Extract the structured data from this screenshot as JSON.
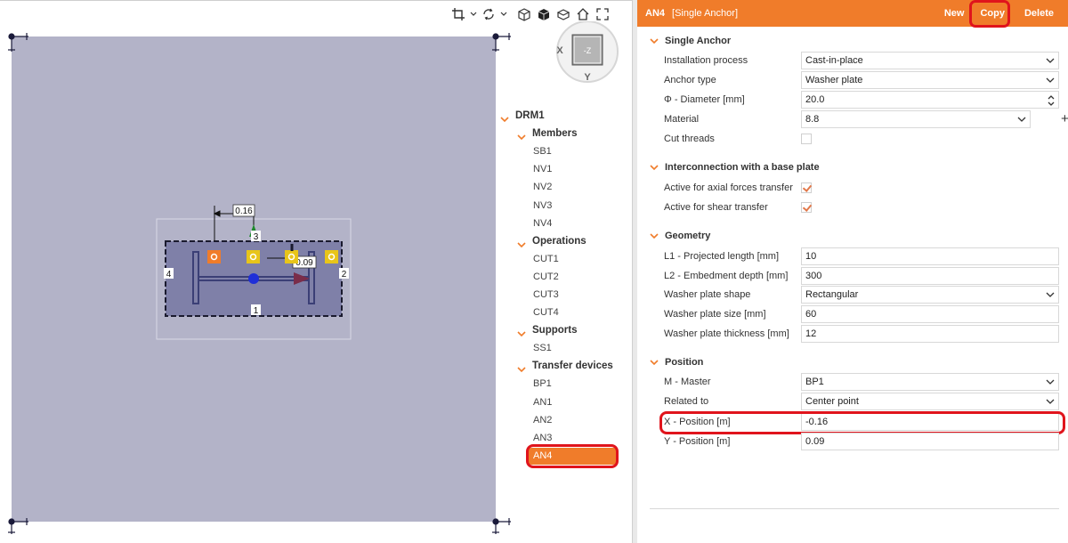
{
  "header": {
    "id": "AN4",
    "title": "[Single Anchor]",
    "new_label": "New",
    "copy_label": "Copy",
    "delete_label": "Delete",
    "accent": "#f07c2a"
  },
  "navcube": {
    "face": "-Z",
    "x_label": "X",
    "y_label": "Y"
  },
  "drawing": {
    "dim_label": "0.16",
    "offset_label": "0.09",
    "edge_labels": [
      "1",
      "2",
      "3",
      "4"
    ]
  },
  "tree": {
    "root": "DRM1",
    "groups": [
      {
        "label": "Members",
        "items": [
          "SB1",
          "NV1",
          "NV2",
          "NV3",
          "NV4"
        ]
      },
      {
        "label": "Operations",
        "items": [
          "CUT1",
          "CUT2",
          "CUT3",
          "CUT4"
        ]
      },
      {
        "label": "Supports",
        "items": [
          "SS1"
        ]
      },
      {
        "label": "Transfer devices",
        "items": [
          "BP1",
          "AN1",
          "AN2",
          "AN3",
          "AN4"
        ]
      }
    ],
    "selected": "AN4"
  },
  "sections": {
    "single_anchor": {
      "title": "Single Anchor",
      "installation_process": {
        "label": "Installation process",
        "value": "Cast-in-place"
      },
      "anchor_type": {
        "label": "Anchor type",
        "value": "Washer plate"
      },
      "diameter": {
        "label": "Φ - Diameter [mm]",
        "value": "20.0"
      },
      "material": {
        "label": "Material",
        "value": "8.8"
      },
      "cut_threads": {
        "label": "Cut threads",
        "checked": false
      }
    },
    "interconnection": {
      "title": "Interconnection with a base plate",
      "axial": {
        "label": "Active for axial forces transfer",
        "checked": true
      },
      "shear": {
        "label": "Active for shear transfer",
        "checked": true
      }
    },
    "geometry": {
      "title": "Geometry",
      "l1": {
        "label": "L1 - Projected length [mm]",
        "value": "10"
      },
      "l2": {
        "label": "L2 - Embedment depth [mm]",
        "value": "300"
      },
      "shape": {
        "label": "Washer plate shape",
        "value": "Rectangular"
      },
      "size": {
        "label": "Washer plate size [mm]",
        "value": "60"
      },
      "thickness": {
        "label": "Washer plate thickness [mm]",
        "value": "12"
      }
    },
    "position": {
      "title": "Position",
      "master": {
        "label": "M - Master",
        "value": "BP1"
      },
      "related": {
        "label": "Related to",
        "value": "Center point"
      },
      "x": {
        "label": "X - Position [m]",
        "value": "-0.16"
      },
      "y": {
        "label": "Y - Position [m]",
        "value": "0.09"
      }
    }
  },
  "icons": [
    "crop-icon",
    "rotate-icon",
    "wireframe-cube-icon",
    "solid-cube-icon",
    "section-icon",
    "home-icon",
    "fullscreen-icon"
  ]
}
